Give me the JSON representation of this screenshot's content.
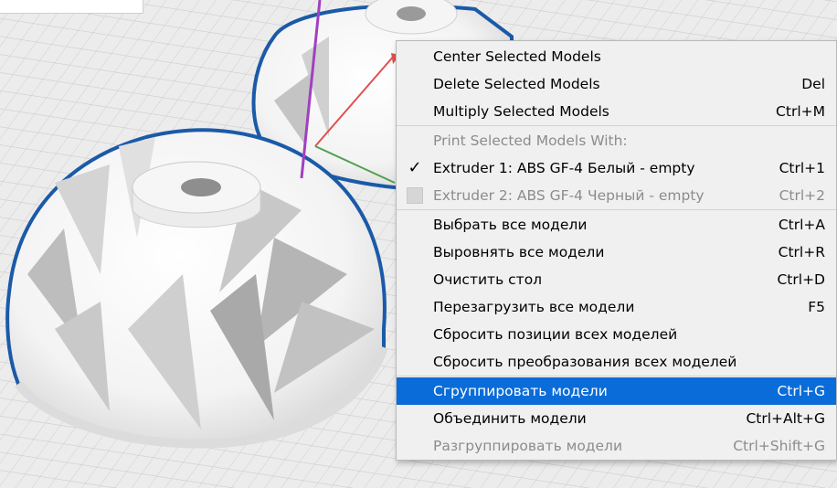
{
  "menu": {
    "items": [
      {
        "label": "Center Selected Models",
        "shortcut": ""
      },
      {
        "label": "Delete Selected Models",
        "shortcut": "Del"
      },
      {
        "label": "Multiply Selected Models",
        "shortcut": "Ctrl+M"
      },
      {
        "label": "Print Selected Models With:",
        "shortcut": ""
      },
      {
        "label": "Extruder 1: ABS GF-4 Белый - empty",
        "shortcut": "Ctrl+1"
      },
      {
        "label": "Extruder 2: ABS GF-4 Черный - empty",
        "shortcut": "Ctrl+2"
      },
      {
        "label": "Выбрать все модели",
        "shortcut": "Ctrl+A"
      },
      {
        "label": "Выровнять все модели",
        "shortcut": "Ctrl+R"
      },
      {
        "label": "Очистить стол",
        "shortcut": "Ctrl+D"
      },
      {
        "label": "Перезагрузить все модели",
        "shortcut": "F5"
      },
      {
        "label": "Сбросить позиции всех моделей",
        "shortcut": ""
      },
      {
        "label": "Сбросить преобразования всех моделей",
        "shortcut": ""
      },
      {
        "label": "Сгруппировать модели",
        "shortcut": "Ctrl+G"
      },
      {
        "label": "Объединить модели",
        "shortcut": "Ctrl+Alt+G"
      },
      {
        "label": "Разгруппировать модели",
        "shortcut": "Ctrl+Shift+G"
      }
    ],
    "checkmark": "✓"
  },
  "colors": {
    "highlight": "#0a6cd8",
    "model_outline": "#1a5aa8",
    "axis_x": "#e05050",
    "axis_y": "#50a050",
    "axis_z": "#a040c0"
  }
}
